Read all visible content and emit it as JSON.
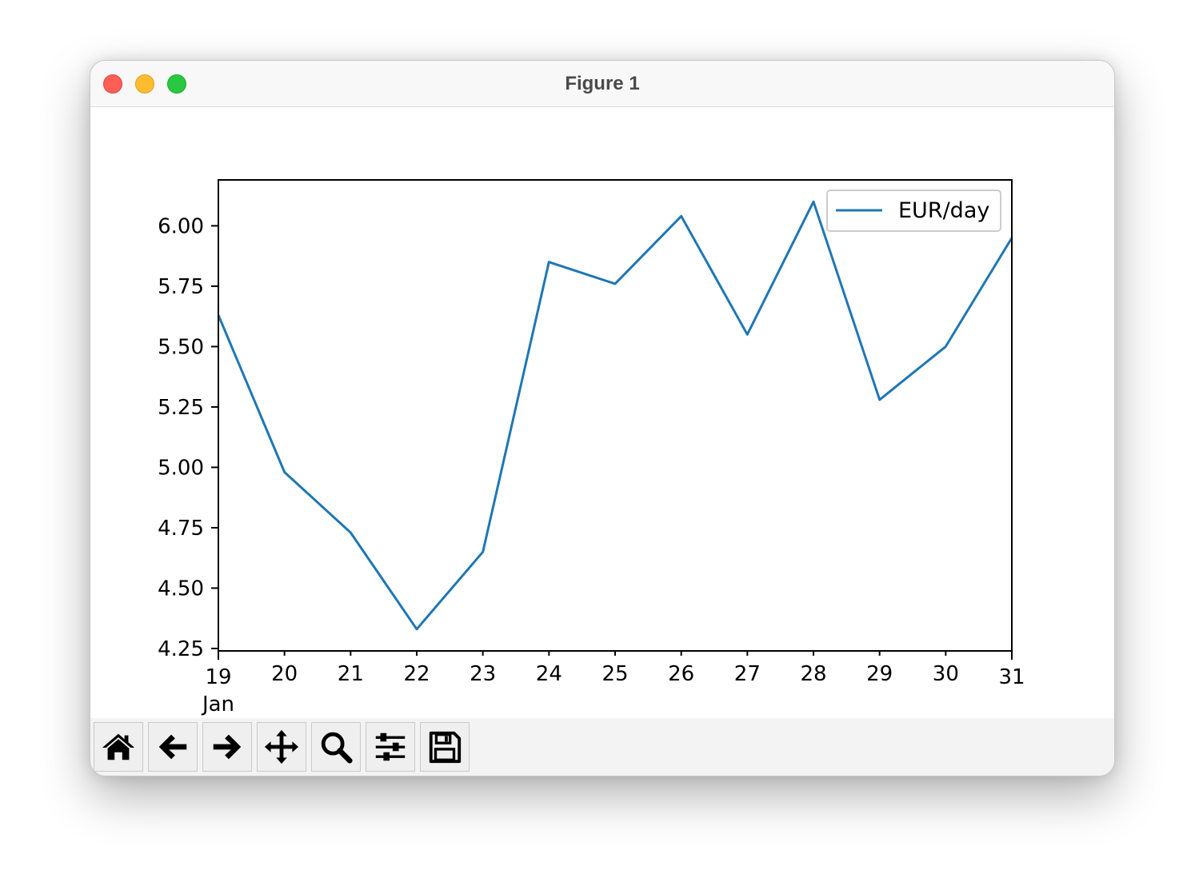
{
  "window": {
    "title": "Figure 1"
  },
  "toolbar": {
    "buttons": [
      {
        "icon": "home-icon",
        "name": "home-button"
      },
      {
        "icon": "back-arrow-icon",
        "name": "back-button"
      },
      {
        "icon": "forward-arrow-icon",
        "name": "forward-button"
      },
      {
        "icon": "pan-move-icon",
        "name": "pan-button"
      },
      {
        "icon": "zoom-magnifier-icon",
        "name": "zoom-button"
      },
      {
        "icon": "sliders-icon",
        "name": "configure-subplots-button"
      },
      {
        "icon": "floppy-disk-icon",
        "name": "save-button"
      }
    ]
  },
  "chart_data": {
    "type": "line",
    "title": "",
    "xlabel": "",
    "ylabel": "",
    "x": [
      "2024-01-19",
      "2024-01-20",
      "2024-01-21",
      "2024-01-22",
      "2024-01-23",
      "2024-01-24",
      "2024-01-25",
      "2024-01-26",
      "2024-01-27",
      "2024-01-28",
      "2024-01-29",
      "2024-01-30",
      "2024-01-31"
    ],
    "x_tick_labels": [
      "19",
      "20",
      "21",
      "22",
      "23",
      "24",
      "25",
      "26",
      "27",
      "28",
      "29",
      "30",
      "31"
    ],
    "x_month_label": "Jan",
    "xlim": [
      "2024-01-19",
      "2024-01-31"
    ],
    "ylim": [
      4.24,
      6.19
    ],
    "y_ticks": [
      4.25,
      4.5,
      4.75,
      5.0,
      5.25,
      5.5,
      5.75,
      6.0
    ],
    "y_tick_labels": [
      "4.25",
      "4.50",
      "4.75",
      "5.00",
      "5.25",
      "5.50",
      "5.75",
      "6.00"
    ],
    "grid": false,
    "legend": "upper right",
    "series": [
      {
        "name": "EUR/day",
        "color": "#1f77b4",
        "values": [
          5.63,
          4.98,
          4.73,
          4.33,
          4.65,
          5.85,
          5.76,
          6.04,
          5.55,
          6.1,
          5.28,
          5.5,
          5.95
        ]
      }
    ]
  }
}
